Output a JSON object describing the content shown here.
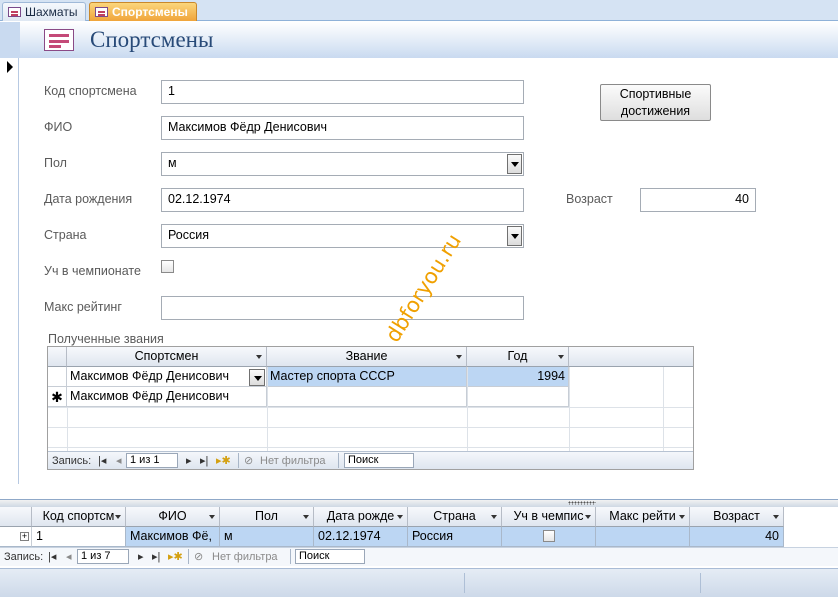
{
  "tabs": [
    {
      "label": "Шахматы",
      "active": false
    },
    {
      "label": "Спортсмены",
      "active": true
    }
  ],
  "form": {
    "title": "Спортсмены",
    "fields": {
      "code_label": "Код спортсмена",
      "code_value": "1",
      "fio_label": "ФИО",
      "fio_value": "Максимов Фёдр Денисович",
      "sex_label": "Пол",
      "sex_value": "м",
      "birth_label": "Дата рождения",
      "birth_value": "02.12.1974",
      "country_label": "Страна",
      "country_value": "Россия",
      "champ_label": "Уч в чемпионате",
      "champ_checked": false,
      "rating_label": "Макс рейтинг",
      "rating_value": "",
      "age_label": "Возраст",
      "age_value": "40"
    },
    "achievements_button": "Спортивные достижения",
    "watermark": "dbforyou.ru"
  },
  "subform": {
    "caption": "Полученные звания",
    "columns": [
      "Спортсмен",
      "Звание",
      "Год"
    ],
    "rows": [
      {
        "athlete": "Максимов Фёдр Денисович",
        "title": "Мастер спорта СССР",
        "year": "1994"
      }
    ],
    "new_row": {
      "marker": "✱",
      "athlete": "Максимов Фёдр Денисович"
    },
    "nav": {
      "label": "Запись:",
      "position": "1 из 1",
      "filter": "Нет фильтра",
      "search": "Поиск"
    }
  },
  "datasheet": {
    "columns": [
      "Код спортсм",
      "ФИО",
      "Пол",
      "Дата рожде",
      "Страна",
      "Уч в чемпис",
      "Макс рейти",
      "Возраст"
    ],
    "row": {
      "code": "1",
      "fio": "Максимов Фё,",
      "sex": "м",
      "birth": "02.12.1974",
      "country": "Россия",
      "champ": false,
      "rating": "",
      "age": "40"
    },
    "nav": {
      "label": "Запись:",
      "position": "1 из 7",
      "filter": "Нет фильтра",
      "search": "Поиск"
    }
  },
  "colors": {
    "accent_tab": "#f0a43a",
    "selected_row": "#bcd6f3",
    "title": "#284a78"
  }
}
